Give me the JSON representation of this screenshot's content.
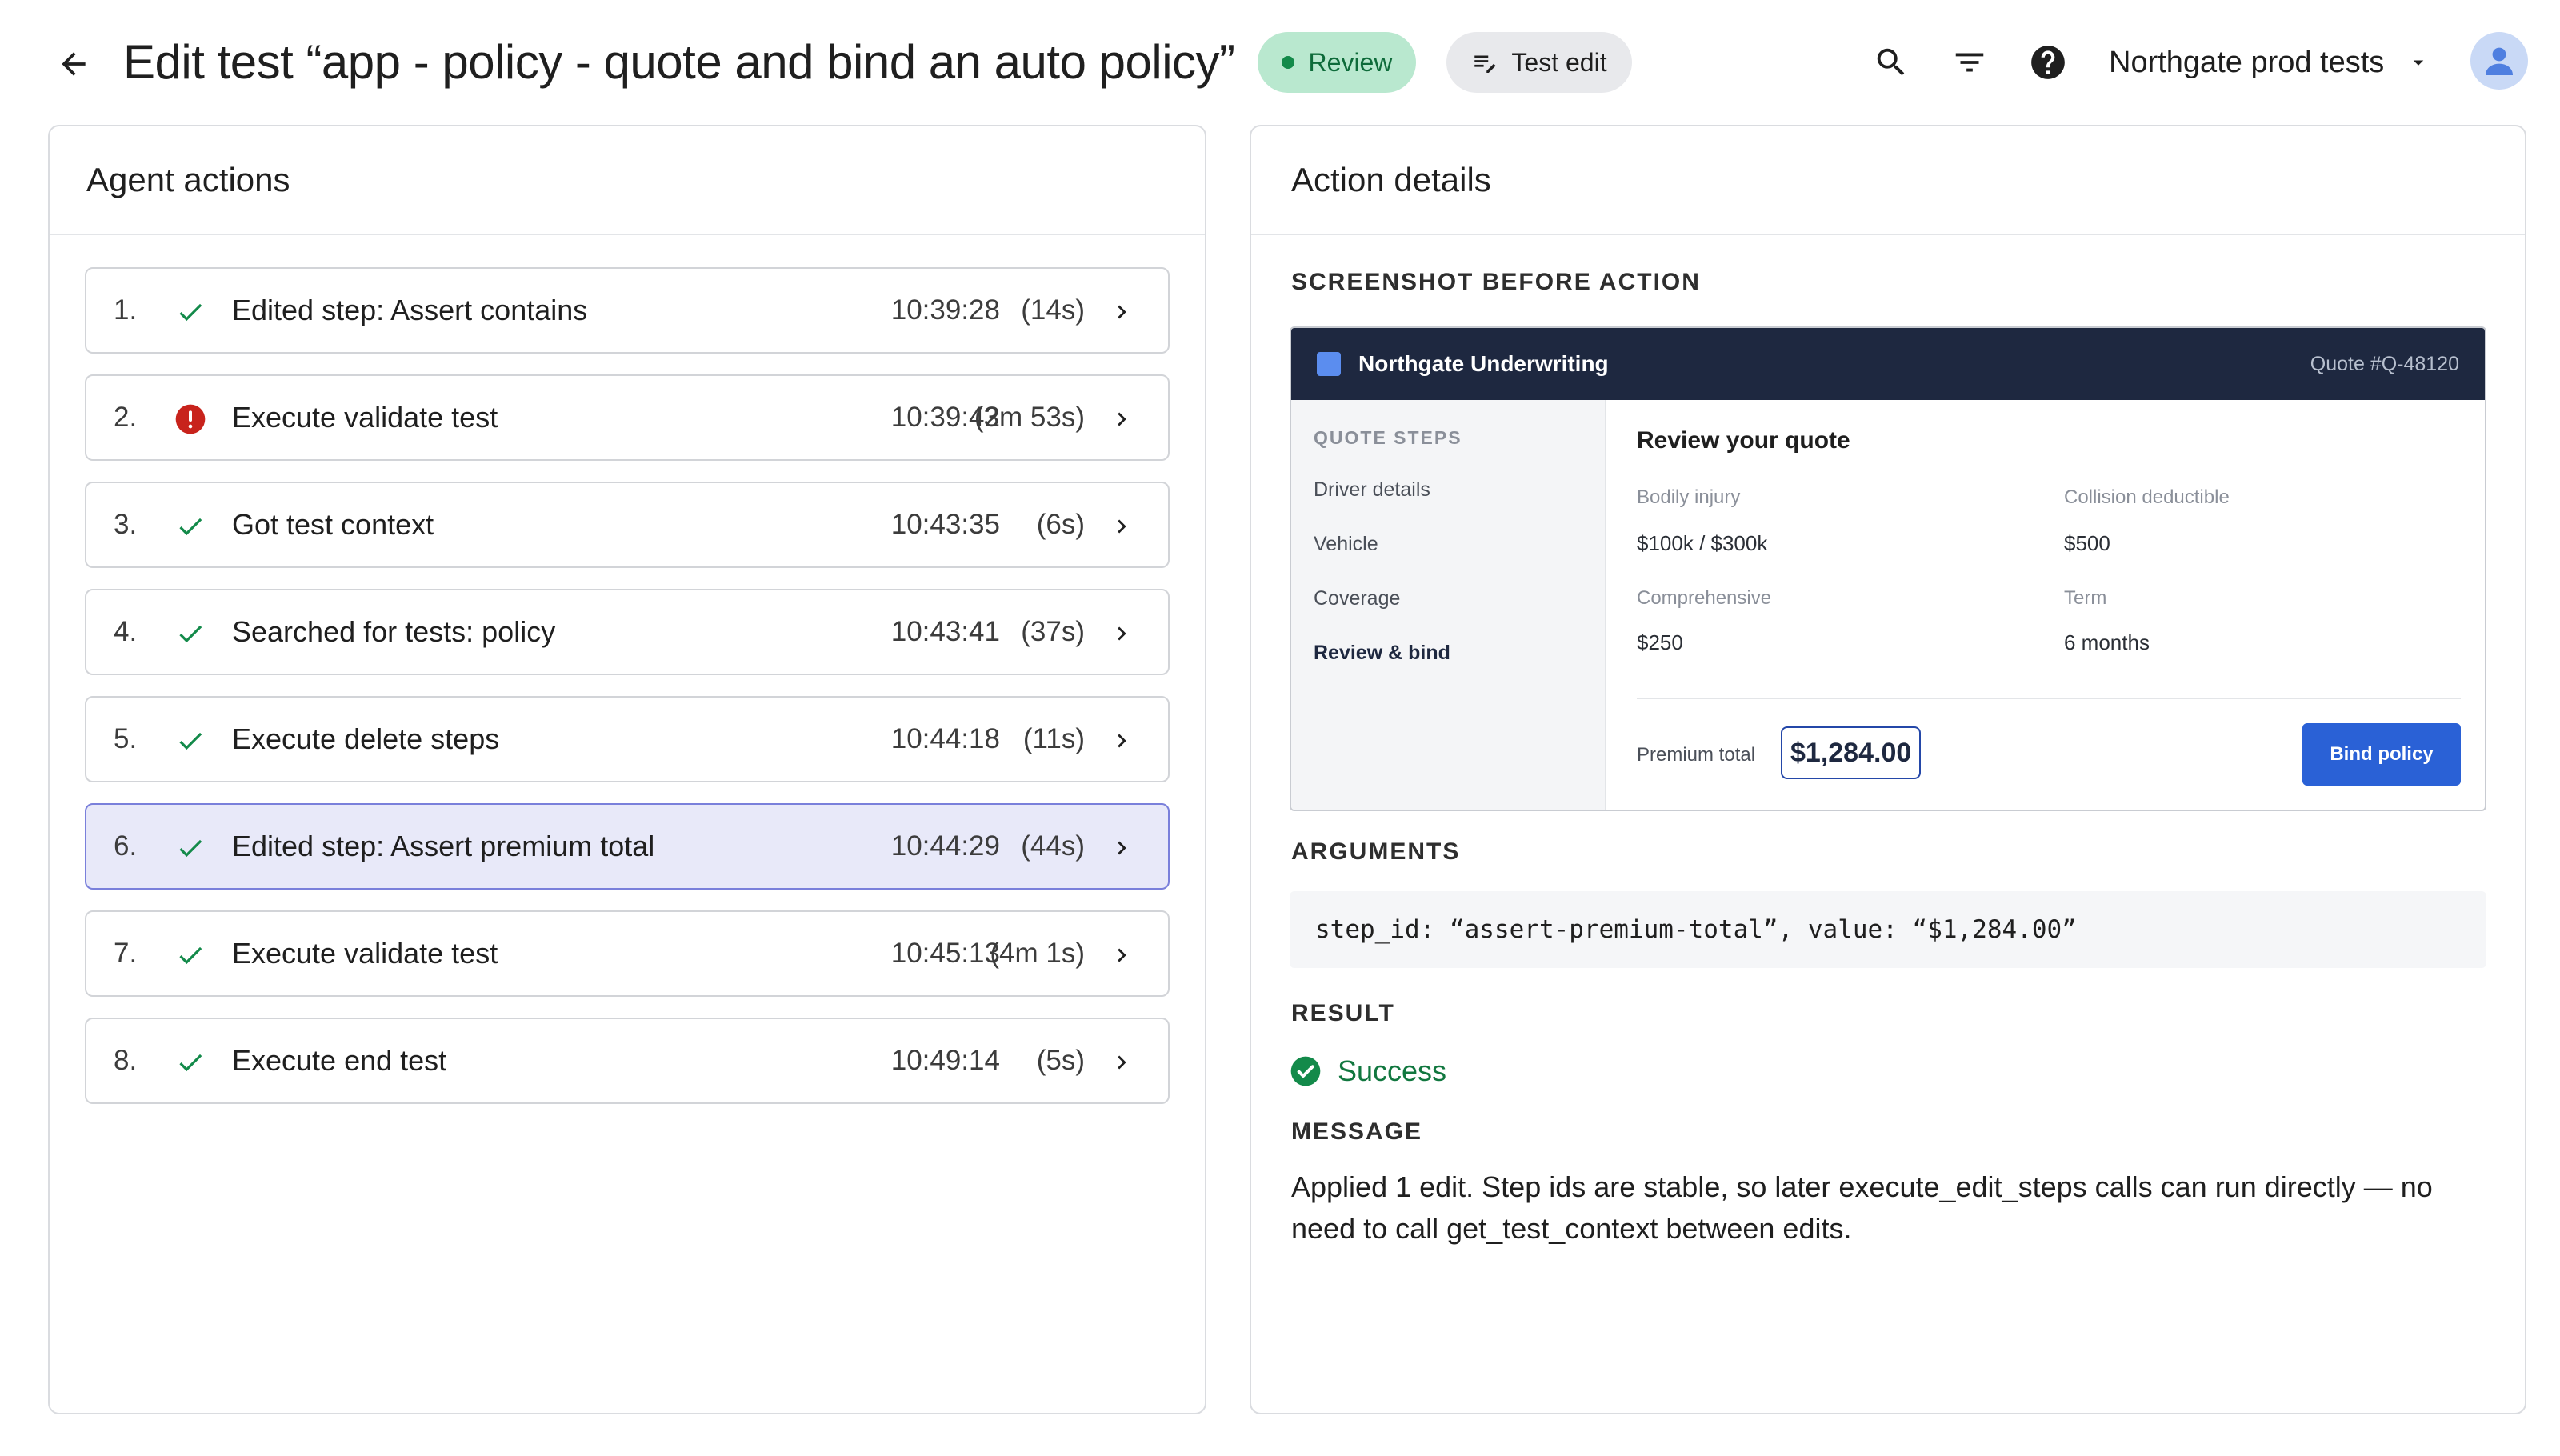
{
  "header": {
    "title": "Edit test “app - policy - quote and bind an auto policy”",
    "status_label": "Review",
    "mode_label": "Test edit",
    "org_name": "Northgate prod tests",
    "icons": [
      "back-arrow-icon",
      "search-icon",
      "filter-icon",
      "help-icon",
      "dropdown-caret-icon",
      "user-avatar-icon"
    ]
  },
  "agent_actions": {
    "title": "Agent actions",
    "items": [
      {
        "num": "1.",
        "status": "success",
        "label": "Edited step: Assert contains",
        "time": "10:39:28",
        "duration": "(14s)"
      },
      {
        "num": "2.",
        "status": "error",
        "label": "Execute validate test",
        "time": "10:39:42",
        "duration": "(3m 53s)"
      },
      {
        "num": "3.",
        "status": "success",
        "label": "Got test context",
        "time": "10:43:35",
        "duration": "(6s)"
      },
      {
        "num": "4.",
        "status": "success",
        "label": "Searched for tests: policy",
        "time": "10:43:41",
        "duration": "(37s)"
      },
      {
        "num": "5.",
        "status": "success",
        "label": "Execute delete steps",
        "time": "10:44:18",
        "duration": "(11s)"
      },
      {
        "num": "6.",
        "status": "success",
        "label": "Edited step: Assert premium total",
        "time": "10:44:29",
        "duration": "(44s)",
        "selected": true
      },
      {
        "num": "7.",
        "status": "success",
        "label": "Execute validate test",
        "time": "10:45:13",
        "duration": "(4m 1s)"
      },
      {
        "num": "8.",
        "status": "success",
        "label": "Execute end test",
        "time": "10:49:14",
        "duration": "(5s)"
      }
    ]
  },
  "details": {
    "title": "Action details",
    "screenshot_label": "SCREENSHOT BEFORE ACTION",
    "screenshot": {
      "brand": "Northgate Underwriting",
      "quote_id": "Quote #Q-48120",
      "steps_heading": "QUOTE STEPS",
      "steps": [
        "Driver details",
        "Vehicle",
        "Coverage",
        "Review & bind"
      ],
      "heading": "Review your quote",
      "fields": {
        "bodily_injury_label": "Bodily injury",
        "bodily_injury_value": "$100k / $300k",
        "collision_label": "Collision deductible",
        "collision_value": "$500",
        "comprehensive_label": "Comprehensive",
        "comprehensive_value": "$250",
        "term_label": "Term",
        "term_value": "6 months"
      },
      "premium_label": "Premium total",
      "premium_value": "$1,284.00",
      "bind_label": "Bind policy"
    },
    "arguments_label": "ARGUMENTS",
    "arguments_text": "step_id: “assert-premium-total”, value: “$1,284.00”",
    "result_label": "RESULT",
    "result_text": "Success",
    "message_label": "MESSAGE",
    "message_text": "Applied 1 edit. Step ids are stable, so later execute_edit_steps calls can run directly — no need to call get_test_context between edits."
  },
  "colors": {
    "success": "#138a4a",
    "error": "#c8231c",
    "selected_bg": "#e8e9f9",
    "selected_border": "#7a80db",
    "review_chip_bg": "#b9e8cf"
  }
}
